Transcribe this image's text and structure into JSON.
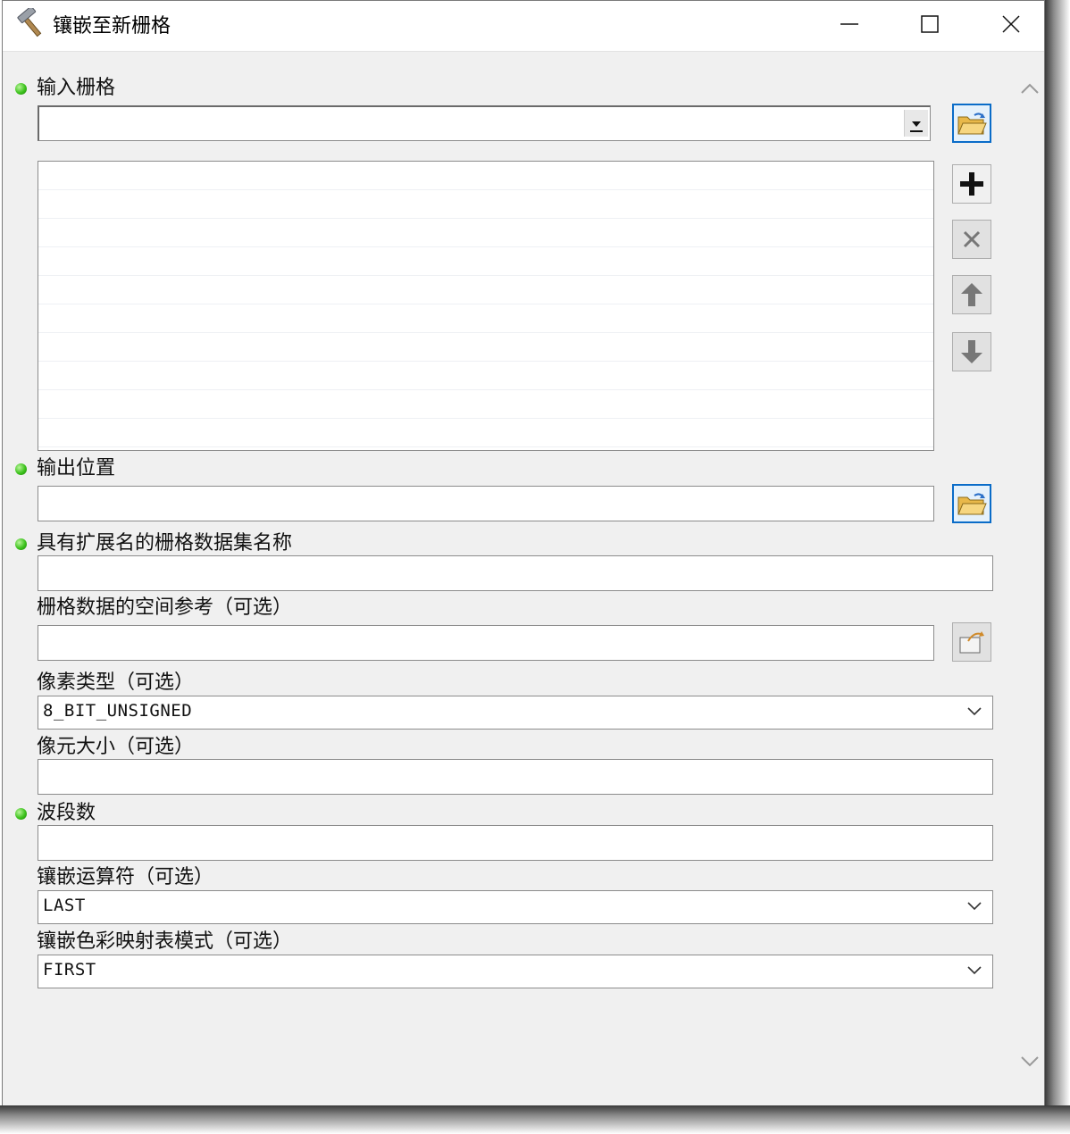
{
  "window": {
    "title": "镶嵌至新栅格",
    "app_icon": "hammer-icon",
    "controls": [
      "minimize-icon",
      "maximize-icon",
      "close-icon"
    ]
  },
  "form": {
    "input_rasters": {
      "label": "输入栅格",
      "required": true,
      "value": ""
    },
    "output_location": {
      "label": "输出位置",
      "required": true,
      "value": ""
    },
    "raster_name": {
      "label": "具有扩展名的栅格数据集名称",
      "required": true,
      "value": ""
    },
    "spatial_reference": {
      "label": "栅格数据的空间参考（可选）",
      "required": false,
      "value": ""
    },
    "pixel_type": {
      "label": "像素类型（可选）",
      "required": false,
      "value": "8_BIT_UNSIGNED"
    },
    "cell_size": {
      "label": "像元大小（可选）",
      "required": false,
      "value": ""
    },
    "band_count": {
      "label": "波段数",
      "required": true,
      "value": ""
    },
    "mosaic_operator": {
      "label": "镶嵌运算符（可选）",
      "required": false,
      "value": "LAST"
    },
    "colormap_mode": {
      "label": "镶嵌色彩映射表模式（可选）",
      "required": false,
      "value": "FIRST"
    }
  },
  "buttons": {
    "browse": "folder-open-icon",
    "add": "plus-icon",
    "remove": "x-icon",
    "move_up": "arrow-up-icon",
    "move_down": "arrow-down-icon",
    "spatial_ref": "spatial-reference-icon"
  },
  "colors": {
    "required_dot": "#3cc21c",
    "accent": "#0a6cc8"
  }
}
